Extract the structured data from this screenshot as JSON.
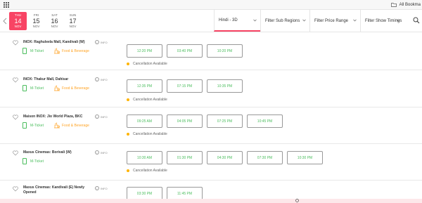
{
  "browser": {
    "bookmarks_label": "All Bookma"
  },
  "dates": [
    {
      "dow": "THU",
      "day": "14",
      "mon": "NOV",
      "active": true
    },
    {
      "dow": "FRI",
      "day": "15",
      "mon": "NOV",
      "active": false
    },
    {
      "dow": "SAT",
      "day": "16",
      "mon": "NOV",
      "active": false
    },
    {
      "dow": "SUN",
      "day": "17",
      "mon": "NOV",
      "active": false
    }
  ],
  "filters": {
    "language": "Hindi - 3D",
    "sub_regions": "Filter Sub Regions",
    "price_range": "Filter Price Range",
    "show_timings": "Filter Show Timings"
  },
  "common": {
    "info": "INFO",
    "mticket": "M-Ticket",
    "food": "Food & Beverage",
    "cancellation": "Cancellation Available"
  },
  "venues": [
    {
      "name": "INOX: Raghuleela Mall, Kandivali (W)",
      "food": true,
      "cancel": true,
      "times": [
        "12:20 PM",
        "03:40 PM",
        "10:20 PM"
      ]
    },
    {
      "name": "INOX: Thakur Mall, Dahisar",
      "food": true,
      "cancel": true,
      "times": [
        "12:35 PM",
        "07:15 PM",
        "10:35 PM"
      ]
    },
    {
      "name": "Maison INOX: Jio World Plaza, BKC",
      "food": true,
      "cancel": true,
      "times": [
        "09:25 AM",
        "04:05 PM",
        "07:25 PM",
        "10:45 PM"
      ]
    },
    {
      "name": "Maxus Cinemas: Borivali (W)",
      "food": false,
      "cancel": true,
      "times": [
        "10:30 AM",
        "01:30 PM",
        "04:30 PM",
        "07:30 PM",
        "10:30 PM"
      ]
    },
    {
      "name": "Maxus Cinemas: Kandivali (E) Newly Opened",
      "food": false,
      "cancel": false,
      "times": [
        "03:30 PM",
        "11:45 PM"
      ]
    }
  ],
  "colors": {
    "accent": "#f84464",
    "available": "#4abd5d",
    "food": "#ffa426",
    "cancel_dot": "#ffb400"
  }
}
